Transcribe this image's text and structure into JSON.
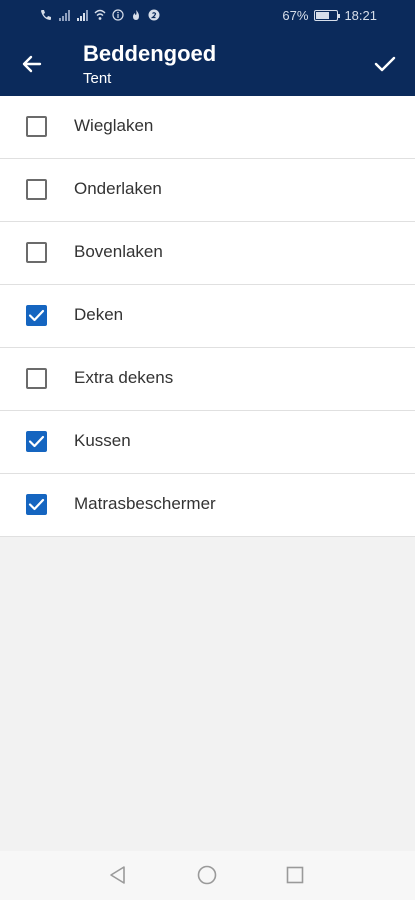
{
  "status_bar": {
    "battery_percent": "67%",
    "time": "18:21",
    "battery_level": 0.67,
    "icons": [
      "call-icon",
      "signal-icon",
      "signal-icon",
      "wifi-icon",
      "info-icon",
      "flame-icon",
      "notification-badge-icon"
    ]
  },
  "app_bar": {
    "title": "Beddengoed",
    "subtitle": "Tent",
    "back_icon": "arrow-left-icon",
    "confirm_icon": "checkmark-icon",
    "background_color": "#0b2a5b"
  },
  "items": [
    {
      "label": "Wieglaken",
      "checked": false
    },
    {
      "label": "Onderlaken",
      "checked": false
    },
    {
      "label": "Bovenlaken",
      "checked": false
    },
    {
      "label": "Deken",
      "checked": true
    },
    {
      "label": "Extra dekens",
      "checked": false
    },
    {
      "label": "Kussen",
      "checked": true
    },
    {
      "label": "Matrasbeschermer",
      "checked": true
    }
  ],
  "colors": {
    "checkbox_checked": "#1565c0",
    "checkbox_unchecked_border": "#6b6b6b",
    "page_background": "#f2f2f2"
  },
  "nav_bar": {
    "buttons": [
      "back-triangle-icon",
      "home-circle-icon",
      "recents-square-icon"
    ]
  }
}
